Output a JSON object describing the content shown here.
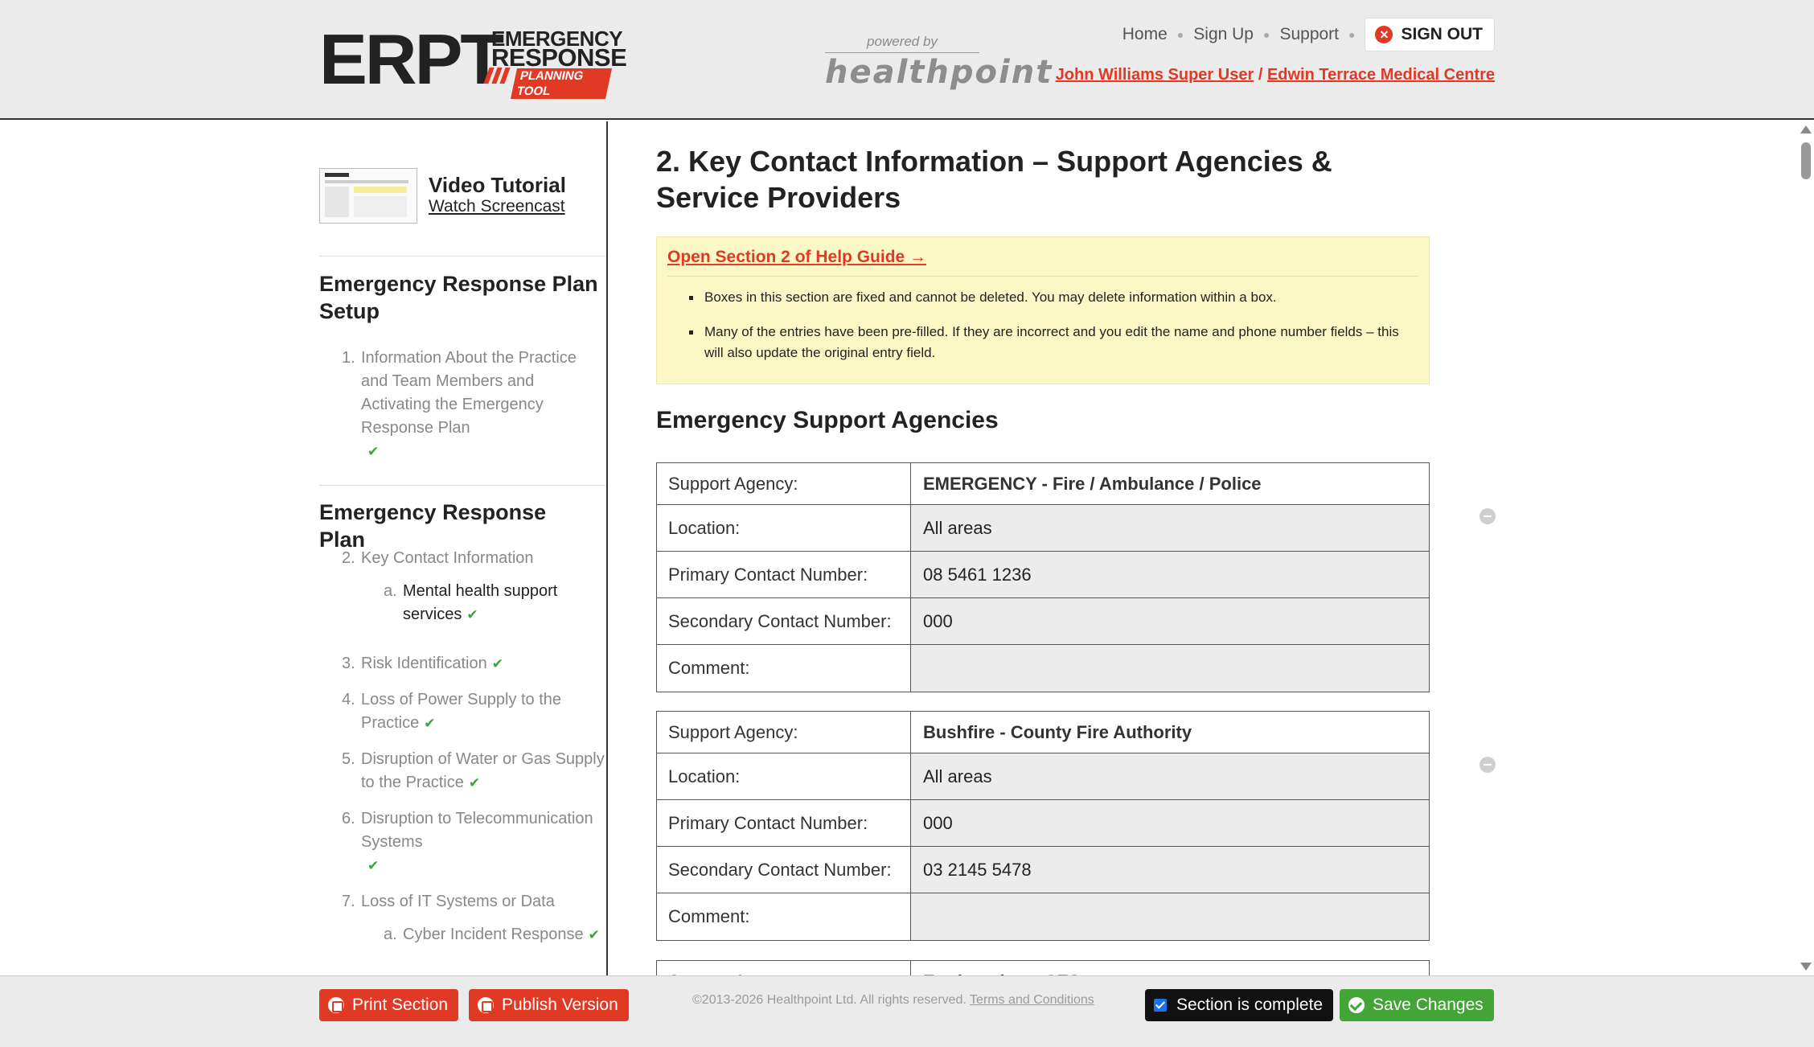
{
  "header": {
    "logo": {
      "main": "ERPT",
      "line1": "EMERGENCY",
      "line2": "RESPONSE",
      "line3": "PLANNING TOOL"
    },
    "powered": {
      "small": "powered by",
      "brand": "healthpoint"
    },
    "nav": {
      "home": "Home",
      "signup": "Sign Up",
      "support": "Support",
      "signout": "SIGN OUT"
    },
    "user": {
      "name": "John Williams Super User",
      "separator": "/",
      "practice": "Edwin Terrace Medical Centre"
    }
  },
  "sidebar": {
    "video": {
      "title": "Video Tutorial",
      "link": "Watch Screencast"
    },
    "setup_heading": "Emergency Response Plan Setup",
    "setup_items": [
      {
        "num": "1.",
        "label": "Information About the Practice and Team Members and Activating the Emergency Response Plan"
      }
    ],
    "plan_heading": "Emergency Response Plan",
    "plan_items": [
      {
        "num": "2.",
        "label": "Key Contact Information"
      },
      {
        "num": "a.",
        "label": "Mental health support services"
      },
      {
        "num": "3.",
        "label": "Risk Identification"
      },
      {
        "num": "4.",
        "label": "Loss of Power Supply to the Practice"
      },
      {
        "num": "5.",
        "label": "Disruption of Water or Gas Supply to the Practice"
      },
      {
        "num": "6.",
        "label": "Disruption to Telecommunication Systems"
      },
      {
        "num": "7.",
        "label": "Loss of IT Systems or Data"
      },
      {
        "num": "a.",
        "label": "Cyber Incident Response"
      }
    ],
    "check_icon": "check-icon"
  },
  "main": {
    "title": "2. Key Contact Information – Support Agencies & Service Providers",
    "help": {
      "link": "Open Section 2 of Help Guide →",
      "bullets": [
        "Boxes in this section are fixed and cannot be deleted. You may delete information within a box.",
        "Many of the entries have been pre-filled. If they are incorrect and you edit the name and phone number fields – this will also update the original entry field."
      ]
    },
    "section_title": "Emergency Support Agencies",
    "labels": {
      "agency": "Support Agency:",
      "location": "Location:",
      "primary": "Primary Contact Number:",
      "secondary": "Secondary Contact Number:",
      "comment": "Comment:"
    },
    "agencies": [
      {
        "agency": "EMERGENCY - Fire / Ambulance / Police",
        "location": "All areas",
        "primary": "08 5461 1236",
        "secondary": "000",
        "comment": ""
      },
      {
        "agency": "Bushfire - County Fire Authority",
        "location": "All areas",
        "primary": "000",
        "secondary": "03 2145 5478",
        "comment": ""
      },
      {
        "agency": "Earthquakes - SES",
        "location": "",
        "primary": "",
        "secondary": "",
        "comment": ""
      }
    ]
  },
  "footer": {
    "print": "Print Section",
    "publish": "Publish Version",
    "copyright": "©2013-2026 Healthpoint Ltd. All rights reserved.",
    "terms": "Terms and Conditions",
    "complete": "Section is complete",
    "save": "Save Changes"
  },
  "colors": {
    "accent": "#e03a24",
    "green": "#43a535",
    "help_bg": "#fcf8c6"
  }
}
